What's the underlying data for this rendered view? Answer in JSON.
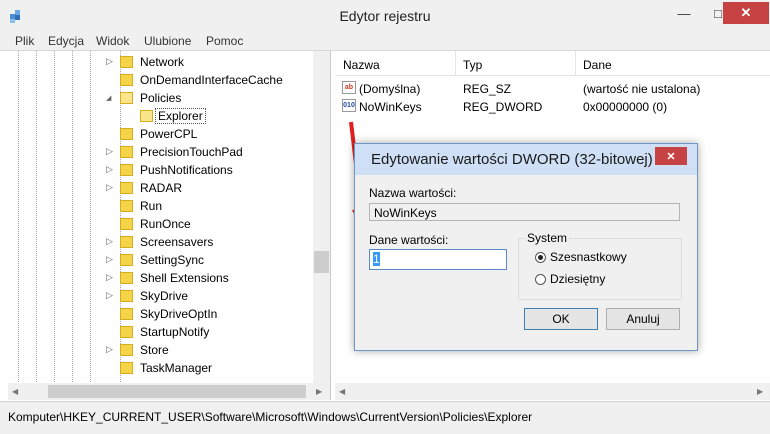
{
  "window": {
    "title": "Edytor rejestru",
    "minimize": "—",
    "maximize": "□",
    "close": "✕"
  },
  "menu": [
    "Plik",
    "Edycja",
    "Widok",
    "Ulubione",
    "Pomoc"
  ],
  "tree": {
    "items": [
      {
        "label": "Network",
        "arrow": "▷"
      },
      {
        "label": "OnDemandInterfaceCache",
        "arrow": ""
      },
      {
        "label": "Policies",
        "arrow": "◢"
      },
      {
        "label": "Explorer",
        "arrow": ""
      },
      {
        "label": "PowerCPL",
        "arrow": ""
      },
      {
        "label": "PrecisionTouchPad",
        "arrow": "▷"
      },
      {
        "label": "PushNotifications",
        "arrow": "▷"
      },
      {
        "label": "RADAR",
        "arrow": "▷"
      },
      {
        "label": "Run",
        "arrow": ""
      },
      {
        "label": "RunOnce",
        "arrow": ""
      },
      {
        "label": "Screensavers",
        "arrow": "▷"
      },
      {
        "label": "SettingSync",
        "arrow": "▷"
      },
      {
        "label": "Shell Extensions",
        "arrow": "▷"
      },
      {
        "label": "SkyDrive",
        "arrow": "▷"
      },
      {
        "label": "SkyDriveOptIn",
        "arrow": ""
      },
      {
        "label": "StartupNotify",
        "arrow": ""
      },
      {
        "label": "Store",
        "arrow": "▷"
      },
      {
        "label": "TaskManager",
        "arrow": ""
      }
    ]
  },
  "list": {
    "headers": [
      "Nazwa",
      "Typ",
      "Dane"
    ],
    "rows": [
      {
        "icon": "ab",
        "name": "(Domyślna)",
        "type": "REG_SZ",
        "data": "(wartość nie ustalona)"
      },
      {
        "icon": "010",
        "name": "NoWinKeys",
        "type": "REG_DWORD",
        "data": "0x00000000 (0)"
      }
    ]
  },
  "status": "Komputer\\HKEY_CURRENT_USER\\Software\\Microsoft\\Windows\\CurrentVersion\\Policies\\Explorer",
  "dialog": {
    "title": "Edytowanie wartości DWORD (32-bitowej)",
    "close": "✕",
    "name_label": "Nazwa wartości:",
    "name_value": "NoWinKeys",
    "data_label": "Dane wartości:",
    "data_value": "1",
    "system_label": "System",
    "hex_label": "Szesnastkowy",
    "dec_label": "Dziesiętny",
    "hex_selected": true,
    "ok": "OK",
    "cancel": "Anuluj"
  },
  "colors": {
    "accent": "#3399ff",
    "close_red": "#c74343",
    "annotation_arrow": "#e02020"
  }
}
